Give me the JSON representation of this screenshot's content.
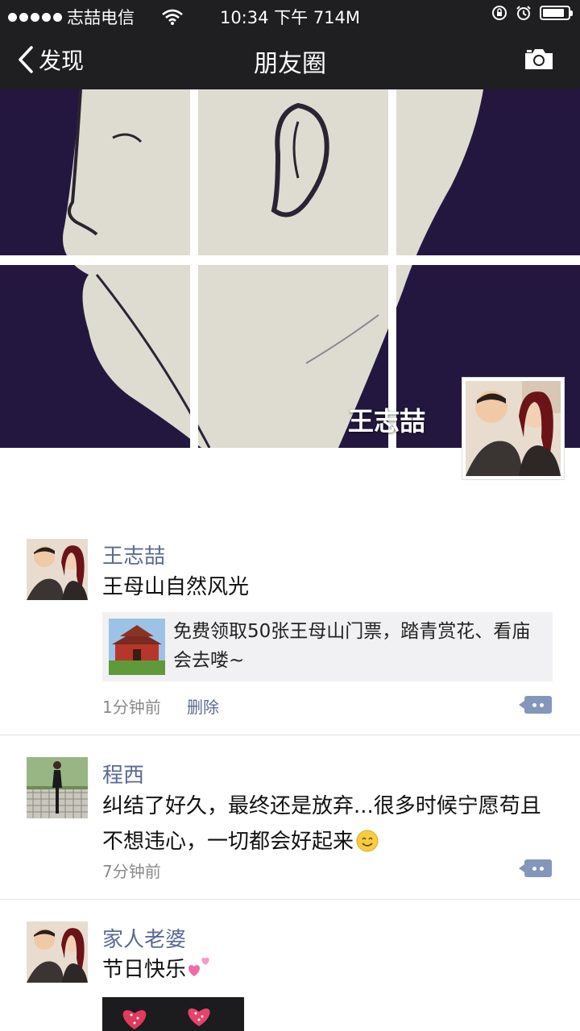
{
  "status": {
    "carrier": "志喆电信",
    "time_text": "10:34 下午 714M",
    "battery_level": 0.85
  },
  "nav": {
    "back_label": "发现",
    "title": "朋友圈"
  },
  "cover": {
    "name": "王志喆"
  },
  "posts": [
    {
      "name": "王志喆",
      "text": "王母山自然风光",
      "share_text": "免费领取50张王母山门票，踏青赏花、看庙会去喽~",
      "time": "1分钟前",
      "delete_label": "删除"
    },
    {
      "name": "程西",
      "text": "纠结了好久，最终还是放弃...很多时候宁愿苟且不想违心，一切都会好起来",
      "time": "7分钟前"
    },
    {
      "name": "家人老婆",
      "text": "节日快乐"
    }
  ],
  "colors": {
    "navbar": "#1f1f22",
    "link": "#5b6a92",
    "cover_bg": "#24173f"
  }
}
